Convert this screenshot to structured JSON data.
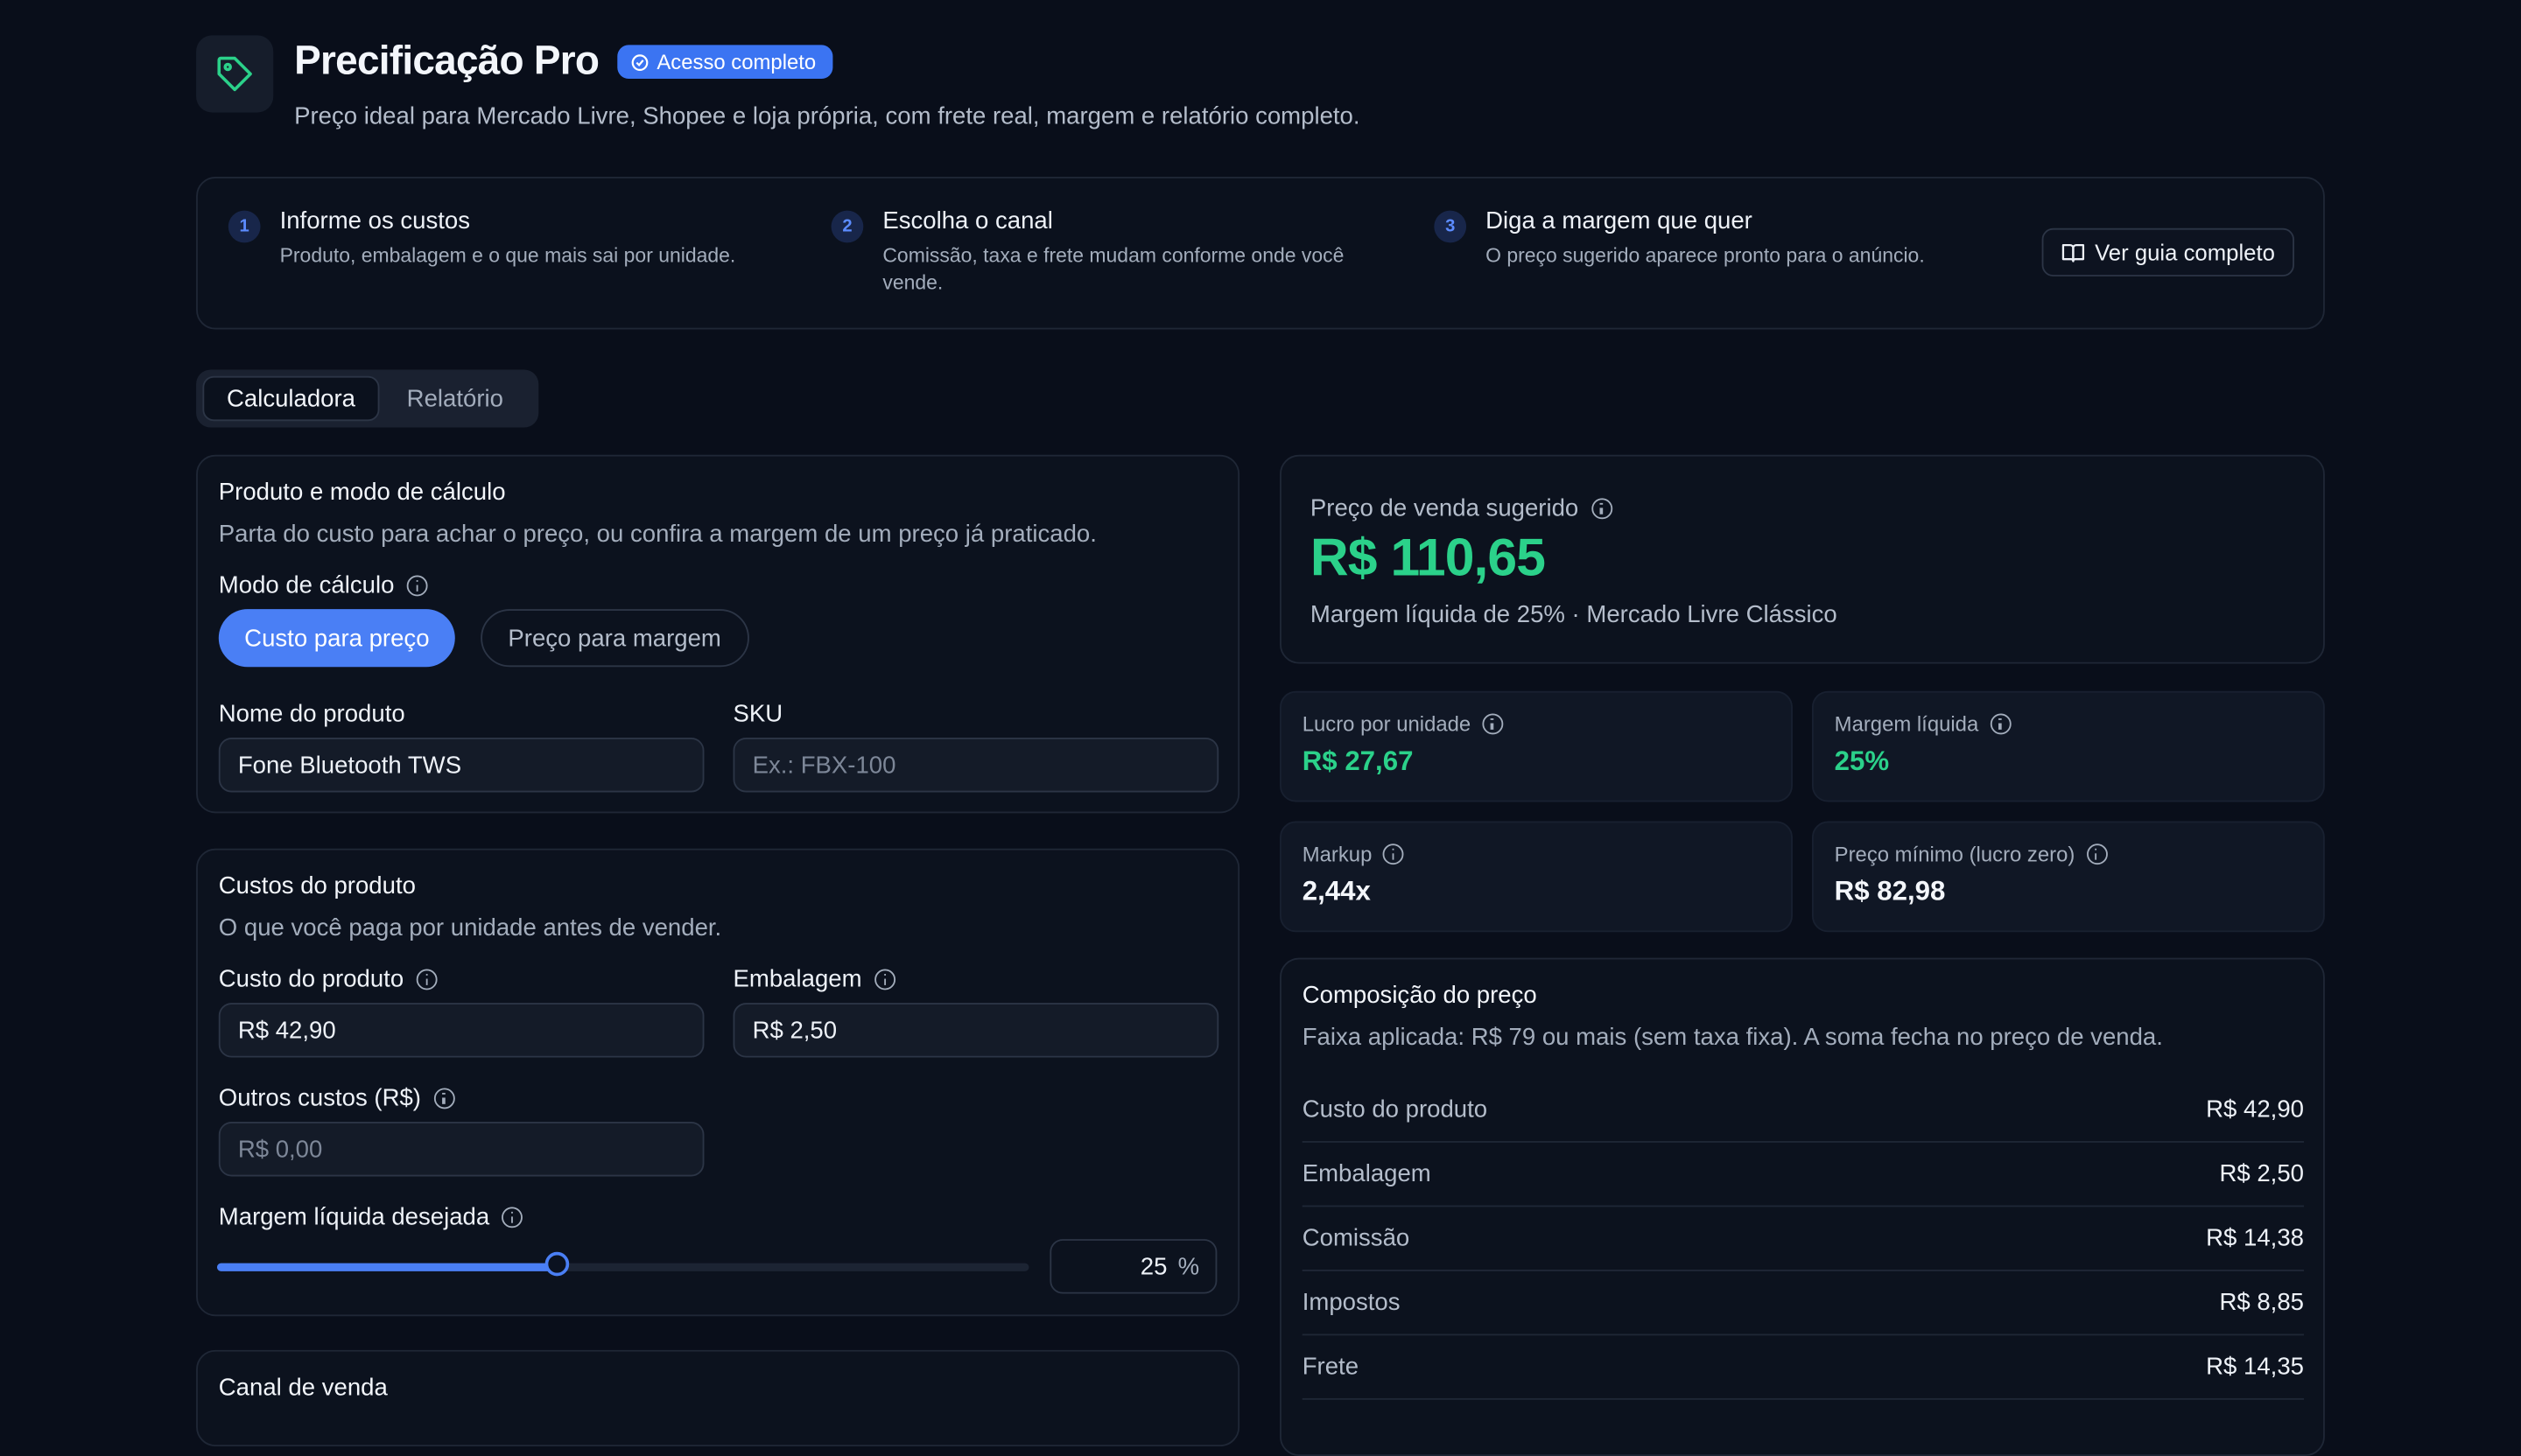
{
  "header": {
    "title": "Precificação Pro",
    "badge": "Acesso completo",
    "subtitle": "Preço ideal para Mercado Livre, Shopee e loja própria, com frete real, margem e relatório completo."
  },
  "steps": [
    {
      "num": "1",
      "title": "Informe os custos",
      "desc": "Produto, embalagem e o que mais sai por unidade."
    },
    {
      "num": "2",
      "title": "Escolha o canal",
      "desc": "Comissão, taxa e frete mudam conforme onde você vende."
    },
    {
      "num": "3",
      "title": "Diga a margem que quer",
      "desc": "O preço sugerido aparece pronto para o anúncio."
    }
  ],
  "guide_button": "Ver guia completo",
  "tabs": {
    "calc": "Calculadora",
    "report": "Relatório"
  },
  "product_card": {
    "title": "Produto e modo de cálculo",
    "subtitle": "Parta do custo para achar o preço, ou confira a margem de um preço já praticado.",
    "mode_label": "Modo de cálculo",
    "mode_active": "Custo para preço",
    "mode_inactive": "Preço para margem",
    "name_label": "Nome do produto",
    "name_value": "Fone Bluetooth TWS",
    "sku_label": "SKU",
    "sku_placeholder": "Ex.: FBX-100"
  },
  "costs_card": {
    "title": "Custos do produto",
    "subtitle": "O que você paga por unidade antes de vender.",
    "product_cost_label": "Custo do produto",
    "product_cost_value": "R$ 42,90",
    "packaging_label": "Embalagem",
    "packaging_value": "R$ 2,50",
    "other_label": "Outros custos (R$)",
    "other_placeholder": "R$ 0,00",
    "margin_label": "Margem líquida desejada",
    "margin_value": "25",
    "margin_unit": "%",
    "margin_fraction": 0.42
  },
  "channel_card": {
    "title": "Canal de venda"
  },
  "result": {
    "label": "Preço de venda sugerido",
    "price": "R$ 110,65",
    "sub": "Margem líquida de 25% · Mercado Livre Clássico"
  },
  "metrics": [
    {
      "label": "Lucro por unidade",
      "value": "R$ 27,67"
    },
    {
      "label": "Margem líquida",
      "value": "25%"
    },
    {
      "label": "Markup",
      "value": "2,44x"
    },
    {
      "label": "Preço mínimo (lucro zero)",
      "value": "R$ 82,98"
    }
  ],
  "composition": {
    "title": "Composição do preço",
    "subtitle": "Faixa aplicada: R$ 79 ou mais (sem taxa fixa). A soma fecha no preço de venda.",
    "rows": [
      {
        "name": "Custo do produto",
        "value": "R$ 42,90"
      },
      {
        "name": "Embalagem",
        "value": "R$ 2,50"
      },
      {
        "name": "Comissão",
        "value": "R$ 14,38"
      },
      {
        "name": "Impostos",
        "value": "R$ 8,85"
      },
      {
        "name": "Frete",
        "value": "R$ 14,35"
      }
    ]
  },
  "colors": {
    "accent": "#4a7ff5",
    "positive": "#2bd18a",
    "background": "#090e1a"
  }
}
